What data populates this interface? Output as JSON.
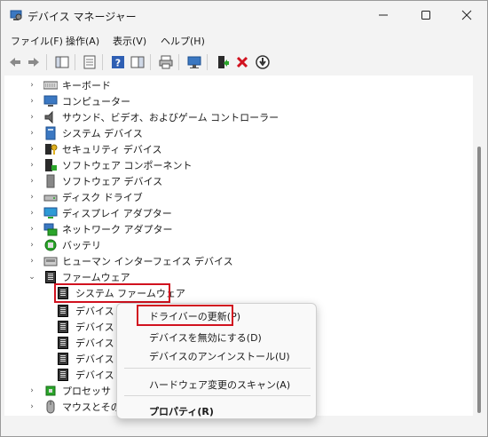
{
  "title": "デバイス マネージャー",
  "window_controls": {
    "minimize": "—",
    "maximize": "☐",
    "close": "✕"
  },
  "menu": [
    "ファイル(F)",
    "操作(A)",
    "表示(V)",
    "ヘルプ(H)"
  ],
  "tree": [
    {
      "label": "キーボード",
      "icon": "keyboard-icon"
    },
    {
      "label": "コンピューター",
      "icon": "computer-icon"
    },
    {
      "label": "サウンド、ビデオ、およびゲーム コントローラー",
      "icon": "speaker-icon"
    },
    {
      "label": "システム デバイス",
      "icon": "system-device-icon"
    },
    {
      "label": "セキュリティ デバイス",
      "icon": "security-device-icon"
    },
    {
      "label": "ソフトウェア コンポーネント",
      "icon": "software-component-icon"
    },
    {
      "label": "ソフトウェア デバイス",
      "icon": "software-device-icon"
    },
    {
      "label": "ディスク ドライブ",
      "icon": "disk-drive-icon"
    },
    {
      "label": "ディスプレイ アダプター",
      "icon": "display-adapter-icon"
    },
    {
      "label": "ネットワーク アダプター",
      "icon": "network-adapter-icon"
    },
    {
      "label": "バッテリ",
      "icon": "battery-icon"
    },
    {
      "label": "ヒューマン インターフェイス デバイス",
      "icon": "hid-icon"
    },
    {
      "label": "ファームウェア",
      "icon": "firmware-icon",
      "expanded": true
    }
  ],
  "firmware_children": [
    "システム ファームウェア",
    "デバイス フ",
    "デバイス フ",
    "デバイス フ",
    "デバイス フ",
    "デバイス フ"
  ],
  "tree_after": [
    {
      "label": "プロセッサ",
      "icon": "processor-icon"
    },
    {
      "label": "マウスとそのほ",
      "icon": "mouse-icon"
    }
  ],
  "context_menu": {
    "update_driver": "ドライバーの更新(P)",
    "disable": "デバイスを無効にする(D)",
    "uninstall": "デバイスのアンインストール(U)",
    "scan": "ハードウェア変更のスキャン(A)",
    "properties": "プロパティ(R)"
  }
}
